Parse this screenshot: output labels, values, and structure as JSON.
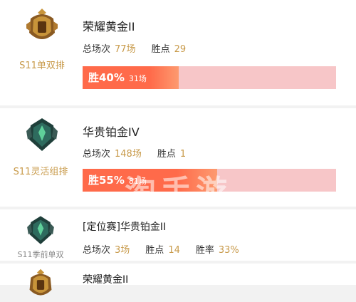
{
  "colors": {
    "gold_value": "#c89a4a",
    "bar_bg": "#f7c6c8",
    "bar_fill": "#ff6a4a",
    "queue_gold": "#c89a4a",
    "queue_gray": "#888888"
  },
  "records": [
    {
      "queue": "S11单双排",
      "rank": "荣耀黄金II",
      "emblem_icon": "gold-rank-emblem-icon",
      "stats": [
        {
          "label": "总场次",
          "value": "77场"
        },
        {
          "label": "胜点",
          "value": "29"
        }
      ],
      "winrate": "胜40%",
      "winrate_value": 0.4,
      "games": "31场"
    },
    {
      "queue": "S11灵活组排",
      "rank": "华贵铂金IV",
      "emblem_icon": "platinum-rank-emblem-icon",
      "stats": [
        {
          "label": "总场次",
          "value": "148场"
        },
        {
          "label": "胜点",
          "value": "1"
        }
      ],
      "winrate": "胜55%",
      "winrate_value": 0.55,
      "games": "81场"
    },
    {
      "queue": "S11季前单双",
      "rank": "[定位赛]华贵铂金II",
      "emblem_icon": "platinum-rank-emblem-icon",
      "stats": [
        {
          "label": "总场次",
          "value": "3场"
        },
        {
          "label": "胜点",
          "value": "14"
        },
        {
          "label": "胜率",
          "value": "33%"
        }
      ]
    },
    {
      "rank": "荣耀黄金II",
      "emblem_icon": "gold-rank-emblem-icon"
    }
  ],
  "watermark": "淘手游"
}
